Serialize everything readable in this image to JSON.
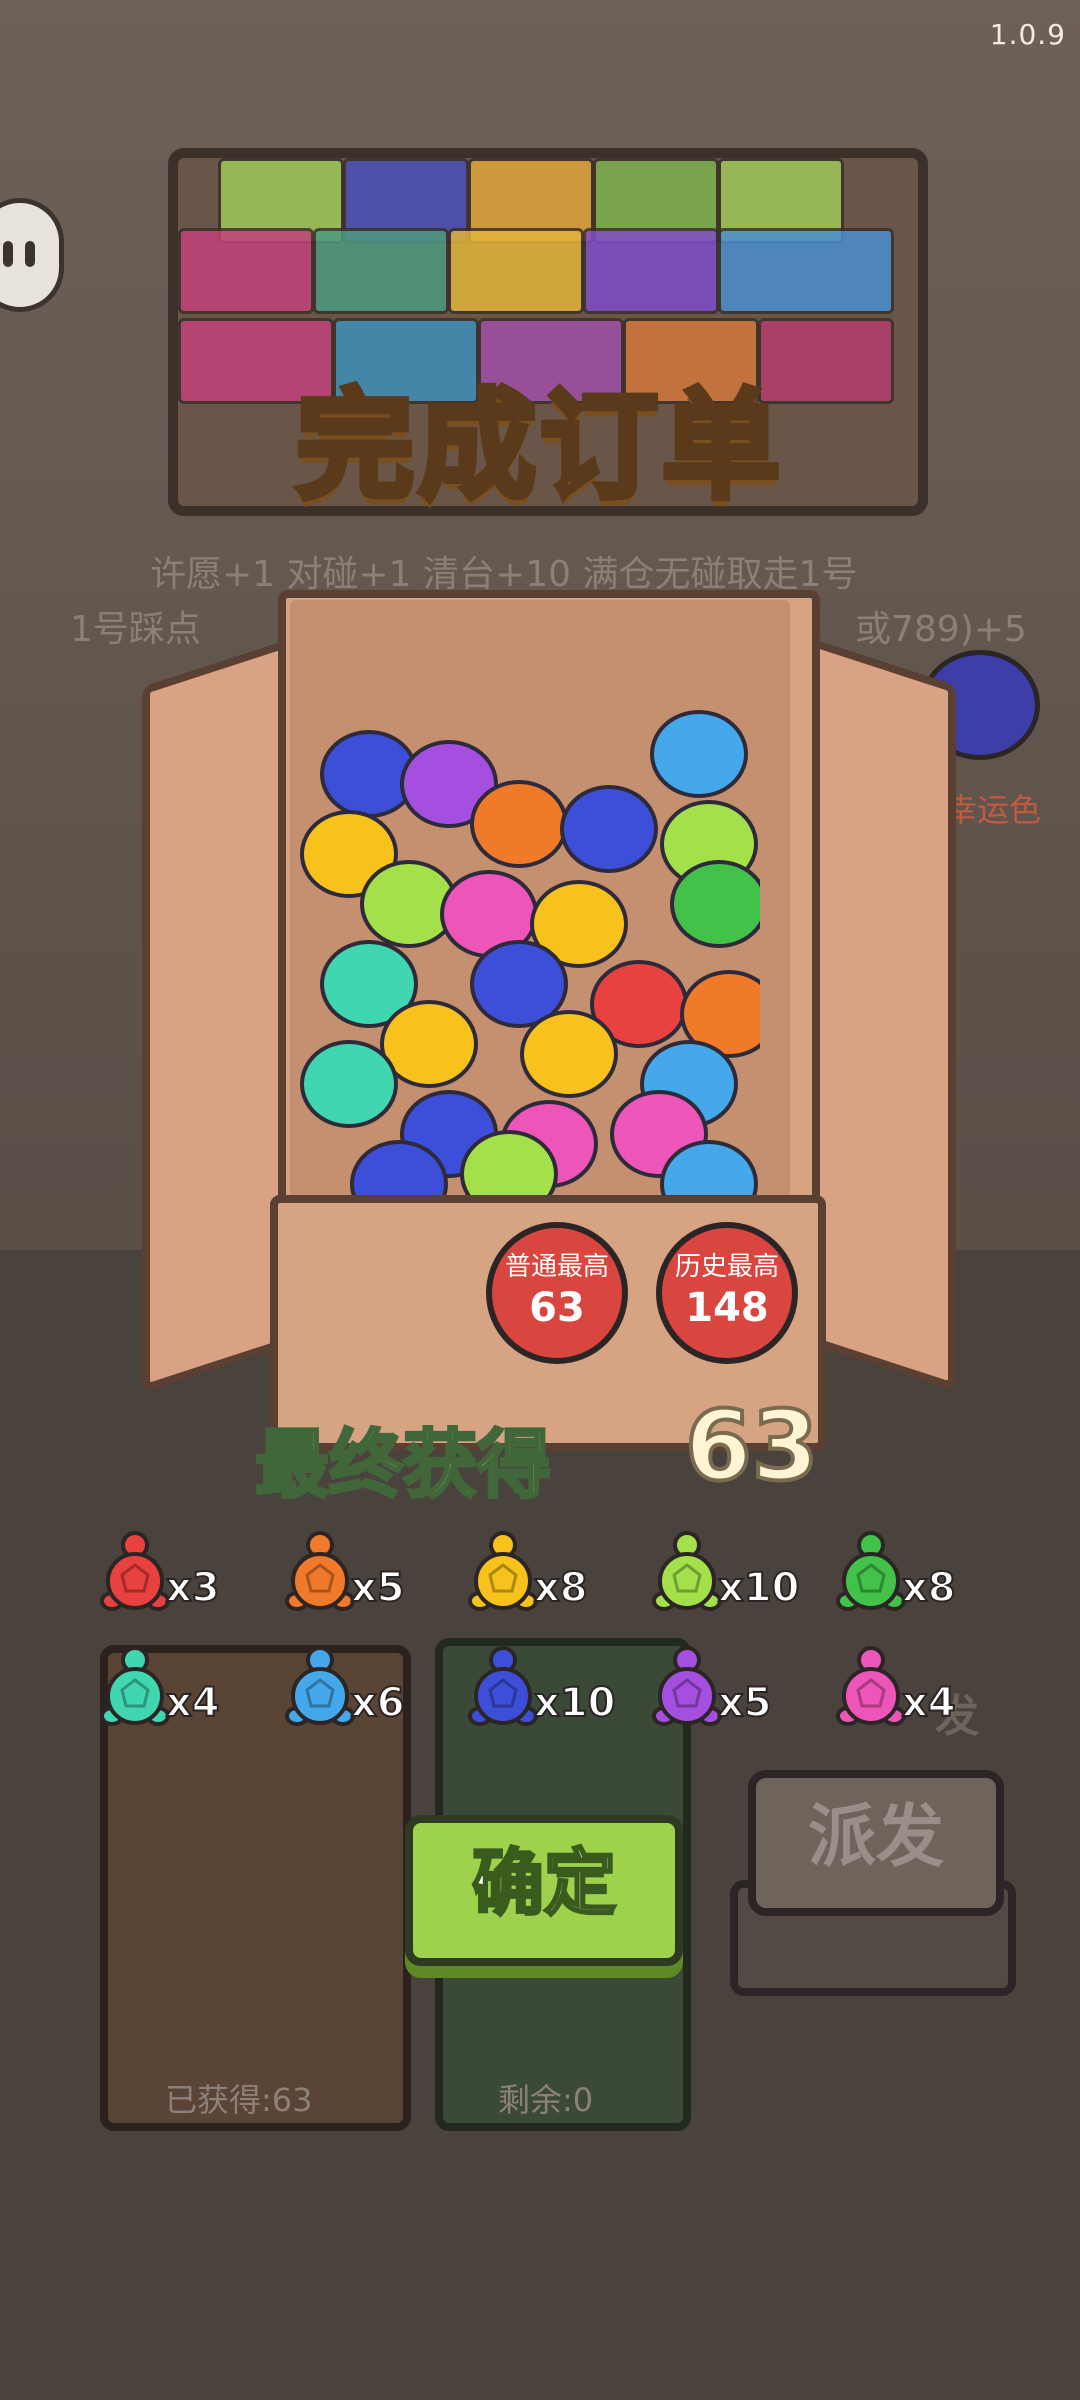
{
  "version": "1.0.9",
  "title": "完成订单",
  "hint_line1": "许愿+1 对碰+1 清台+10 满仓无碰取走1号",
  "hint_line2_left": "1号踩点",
  "hint_line2_right": "或789)+5",
  "lucky_color_label": "幸运色",
  "badges": {
    "normal_best_label": "普通最高",
    "normal_best_value": "63",
    "history_best_label": "历史最高",
    "history_best_value": "148"
  },
  "final": {
    "label": "最终获得",
    "value": "63"
  },
  "tally": [
    {
      "color": "#e8413f",
      "icon": "red-turtle-icon",
      "count": "x3"
    },
    {
      "color": "#f07a2a",
      "icon": "orange-turtle-icon",
      "count": "x5"
    },
    {
      "color": "#f6c21b",
      "icon": "yellow-turtle-icon",
      "count": "x8"
    },
    {
      "color": "#a3e04a",
      "icon": "lime-turtle-icon",
      "count": "x10"
    },
    {
      "color": "#43c24a",
      "icon": "green-turtle-icon",
      "count": "x8"
    },
    {
      "color": "#3fd6b0",
      "icon": "teal-turtle-icon",
      "count": "x4"
    },
    {
      "color": "#44a8ea",
      "icon": "blue-turtle-icon",
      "count": "x6"
    },
    {
      "color": "#3d4fd8",
      "icon": "indigo-turtle-icon",
      "count": "x10"
    },
    {
      "color": "#a54fe0",
      "icon": "purple-turtle-icon",
      "count": "x5"
    },
    {
      "color": "#ee55b8",
      "icon": "pink-turtle-icon",
      "count": "x4"
    }
  ],
  "bins": {
    "obtained_label": "已获得:63",
    "remaining_label": "剩余:0"
  },
  "buttons": {
    "confirm": "确定",
    "dispatch": "派发"
  },
  "dim_fragment": "发"
}
